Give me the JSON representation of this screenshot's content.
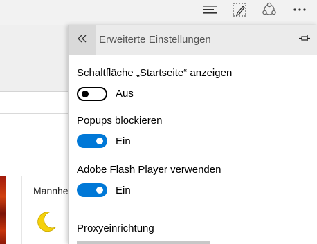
{
  "toolbar": {
    "icons": [
      "hub-icon",
      "web-note-icon",
      "share-icon",
      "more-icon"
    ]
  },
  "background": {
    "card_title": "Mannhe",
    "card_icon": "moon-icon"
  },
  "panel": {
    "back_icon": "double-chevron-left-icon",
    "title": "Erweiterte Einstellungen",
    "pin_icon": "pin-icon",
    "settings": [
      {
        "label": "Schaltfläche „Startseite“ anzeigen",
        "state": "Aus",
        "on": false
      },
      {
        "label": "Popups blockieren",
        "state": "Ein",
        "on": true
      },
      {
        "label": "Adobe Flash Player verwenden",
        "state": "Ein",
        "on": true
      }
    ],
    "proxy_label": "Proxyeinrichtung"
  },
  "colors": {
    "accent": "#0078d7",
    "panel_header": "#ebebeb",
    "back_button": "#d9d9d9"
  }
}
